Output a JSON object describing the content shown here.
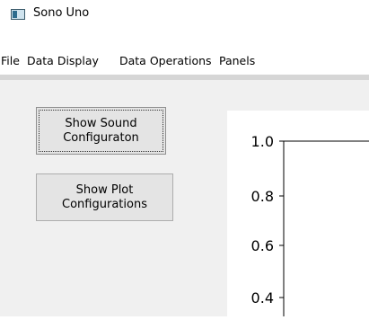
{
  "window": {
    "title": "Sono Uno",
    "icon": "app-window-icon"
  },
  "menubar": {
    "items": [
      {
        "label": "File"
      },
      {
        "label": "Data Display"
      },
      {
        "label": "Data Operations"
      },
      {
        "label": "Panels"
      }
    ]
  },
  "buttons": {
    "show_sound_configuration": "Show Sound\nConfiguraton",
    "show_plot_configurations": "Show Plot\nConfigurations"
  },
  "plot": {
    "y_ticks": [
      "1.0",
      "0.8",
      "0.6",
      "0.4"
    ]
  }
}
